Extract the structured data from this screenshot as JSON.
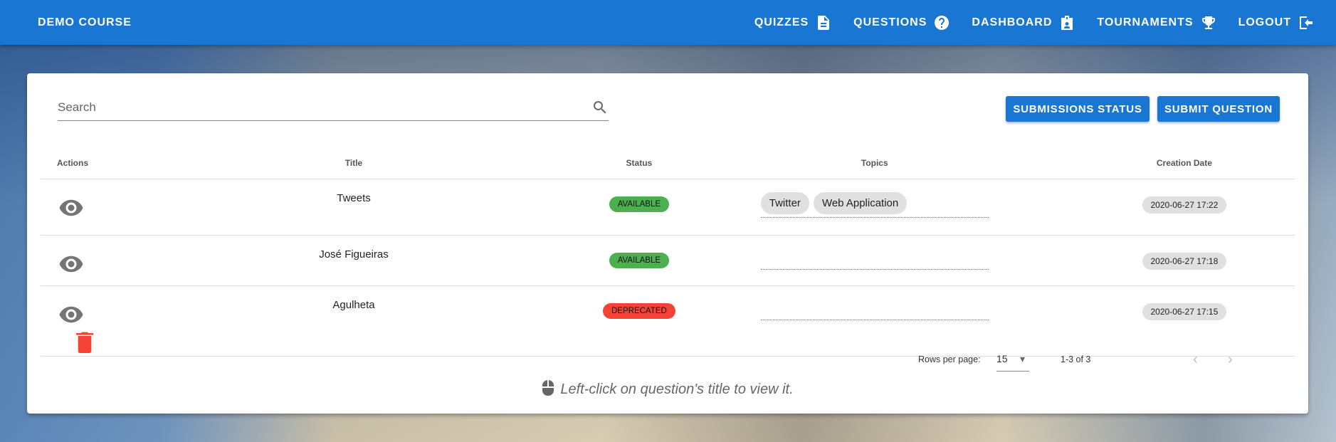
{
  "header": {
    "brand": "DEMO COURSE",
    "nav": [
      {
        "label": "QUIZZES",
        "icon": "file-document-icon"
      },
      {
        "label": "QUESTIONS",
        "icon": "help-circle-icon"
      },
      {
        "label": "DASHBOARD",
        "icon": "badge-account-icon"
      },
      {
        "label": "TOURNAMENTS",
        "icon": "trophy-icon"
      },
      {
        "label": "LOGOUT",
        "icon": "logout-icon"
      }
    ]
  },
  "search": {
    "placeholder": "Search",
    "value": ""
  },
  "buttons": {
    "submissions_status": "SUBMISSIONS STATUS",
    "submit_question": "SUBMIT QUESTION"
  },
  "table": {
    "headers": [
      "Actions",
      "Title",
      "Status",
      "Topics",
      "Creation Date"
    ],
    "rows": [
      {
        "title": "Tweets",
        "status": "AVAILABLE",
        "topics": [
          "Twitter",
          "Web Application"
        ],
        "date": "2020-06-27 17:22",
        "deletable": false
      },
      {
        "title": "José Figueiras",
        "status": "AVAILABLE",
        "topics": [],
        "date": "2020-06-27 17:18",
        "deletable": false
      },
      {
        "title": "Agulheta",
        "status": "DEPRECATED",
        "topics": [],
        "date": "2020-06-27 17:15",
        "deletable": true
      }
    ]
  },
  "status_colors": {
    "AVAILABLE": "#4caf50",
    "DEPRECATED": "#f44336"
  },
  "pagination": {
    "rows_per_page_label": "Rows per page:",
    "rows_per_page": "15",
    "range": "1-3 of 3"
  },
  "hint": "Left-click on question's title to view it."
}
